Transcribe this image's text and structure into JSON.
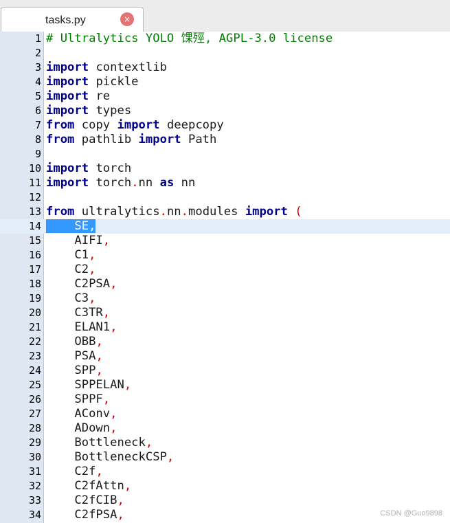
{
  "tab": {
    "title": "tasks.py",
    "close_icon": "×"
  },
  "watermark": "CSDN @Guo9898",
  "colors": {
    "keyword": "#00008b",
    "comment": "#008000",
    "punctuation": "#cc0000",
    "selection": "#3399ff",
    "gutter": "#dfe8f2"
  },
  "current_line": 14,
  "code_lines": [
    {
      "n": "1",
      "tokens": [
        {
          "t": "# Ultralytics YOLO 馃殌, AGPL-3.0 license",
          "c": "cm"
        }
      ]
    },
    {
      "n": "2",
      "tokens": []
    },
    {
      "n": "3",
      "tokens": [
        {
          "t": "import",
          "c": "kw"
        },
        {
          "t": " contextlib",
          "c": ""
        }
      ]
    },
    {
      "n": "4",
      "tokens": [
        {
          "t": "import",
          "c": "kw"
        },
        {
          "t": " pickle",
          "c": ""
        }
      ]
    },
    {
      "n": "5",
      "tokens": [
        {
          "t": "import",
          "c": "kw"
        },
        {
          "t": " re",
          "c": ""
        }
      ]
    },
    {
      "n": "6",
      "tokens": [
        {
          "t": "import",
          "c": "kw"
        },
        {
          "t": " types",
          "c": ""
        }
      ]
    },
    {
      "n": "7",
      "tokens": [
        {
          "t": "from",
          "c": "kw"
        },
        {
          "t": " copy ",
          "c": ""
        },
        {
          "t": "import",
          "c": "kw"
        },
        {
          "t": " deepcopy",
          "c": ""
        }
      ]
    },
    {
      "n": "8",
      "tokens": [
        {
          "t": "from",
          "c": "kw"
        },
        {
          "t": " pathlib ",
          "c": ""
        },
        {
          "t": "import",
          "c": "kw"
        },
        {
          "t": " Path",
          "c": ""
        }
      ]
    },
    {
      "n": "9",
      "tokens": []
    },
    {
      "n": "10",
      "tokens": [
        {
          "t": "import",
          "c": "kw"
        },
        {
          "t": " torch",
          "c": ""
        }
      ]
    },
    {
      "n": "11",
      "tokens": [
        {
          "t": "import",
          "c": "kw"
        },
        {
          "t": " torch",
          "c": ""
        },
        {
          "t": ".",
          "c": "pn"
        },
        {
          "t": "nn ",
          "c": ""
        },
        {
          "t": "as",
          "c": "kw"
        },
        {
          "t": " nn",
          "c": ""
        }
      ]
    },
    {
      "n": "12",
      "tokens": []
    },
    {
      "n": "13",
      "tokens": [
        {
          "t": "from",
          "c": "kw"
        },
        {
          "t": " ultralytics",
          "c": ""
        },
        {
          "t": ".",
          "c": "pn"
        },
        {
          "t": "nn",
          "c": ""
        },
        {
          "t": ".",
          "c": "pn"
        },
        {
          "t": "modules ",
          "c": ""
        },
        {
          "t": "import",
          "c": "kw"
        },
        {
          "t": " (",
          "c": "pn"
        }
      ]
    },
    {
      "n": "14",
      "tokens": [
        {
          "t": "    SE",
          "c": "sel"
        },
        {
          "t": ",",
          "c": "sel"
        }
      ]
    },
    {
      "n": "15",
      "tokens": [
        {
          "t": "    AIFI",
          "c": ""
        },
        {
          "t": ",",
          "c": "pn"
        }
      ]
    },
    {
      "n": "16",
      "tokens": [
        {
          "t": "    C1",
          "c": ""
        },
        {
          "t": ",",
          "c": "pn"
        }
      ]
    },
    {
      "n": "17",
      "tokens": [
        {
          "t": "    C2",
          "c": ""
        },
        {
          "t": ",",
          "c": "pn"
        }
      ]
    },
    {
      "n": "18",
      "tokens": [
        {
          "t": "    C2PSA",
          "c": ""
        },
        {
          "t": ",",
          "c": "pn"
        }
      ]
    },
    {
      "n": "19",
      "tokens": [
        {
          "t": "    C3",
          "c": ""
        },
        {
          "t": ",",
          "c": "pn"
        }
      ]
    },
    {
      "n": "20",
      "tokens": [
        {
          "t": "    C3TR",
          "c": ""
        },
        {
          "t": ",",
          "c": "pn"
        }
      ]
    },
    {
      "n": "21",
      "tokens": [
        {
          "t": "    ELAN1",
          "c": ""
        },
        {
          "t": ",",
          "c": "pn"
        }
      ]
    },
    {
      "n": "22",
      "tokens": [
        {
          "t": "    OBB",
          "c": ""
        },
        {
          "t": ",",
          "c": "pn"
        }
      ]
    },
    {
      "n": "23",
      "tokens": [
        {
          "t": "    PSA",
          "c": ""
        },
        {
          "t": ",",
          "c": "pn"
        }
      ]
    },
    {
      "n": "24",
      "tokens": [
        {
          "t": "    SPP",
          "c": ""
        },
        {
          "t": ",",
          "c": "pn"
        }
      ]
    },
    {
      "n": "25",
      "tokens": [
        {
          "t": "    SPPELAN",
          "c": ""
        },
        {
          "t": ",",
          "c": "pn"
        }
      ]
    },
    {
      "n": "26",
      "tokens": [
        {
          "t": "    SPPF",
          "c": ""
        },
        {
          "t": ",",
          "c": "pn"
        }
      ]
    },
    {
      "n": "27",
      "tokens": [
        {
          "t": "    AConv",
          "c": ""
        },
        {
          "t": ",",
          "c": "pn"
        }
      ]
    },
    {
      "n": "28",
      "tokens": [
        {
          "t": "    ADown",
          "c": ""
        },
        {
          "t": ",",
          "c": "pn"
        }
      ]
    },
    {
      "n": "29",
      "tokens": [
        {
          "t": "    Bottleneck",
          "c": ""
        },
        {
          "t": ",",
          "c": "pn"
        }
      ]
    },
    {
      "n": "30",
      "tokens": [
        {
          "t": "    BottleneckCSP",
          "c": ""
        },
        {
          "t": ",",
          "c": "pn"
        }
      ]
    },
    {
      "n": "31",
      "tokens": [
        {
          "t": "    C2f",
          "c": ""
        },
        {
          "t": ",",
          "c": "pn"
        }
      ]
    },
    {
      "n": "32",
      "tokens": [
        {
          "t": "    C2fAttn",
          "c": ""
        },
        {
          "t": ",",
          "c": "pn"
        }
      ]
    },
    {
      "n": "33",
      "tokens": [
        {
          "t": "    C2fCIB",
          "c": ""
        },
        {
          "t": ",",
          "c": "pn"
        }
      ]
    },
    {
      "n": "34",
      "tokens": [
        {
          "t": "    C2fPSA",
          "c": ""
        },
        {
          "t": ",",
          "c": "pn"
        }
      ]
    }
  ]
}
